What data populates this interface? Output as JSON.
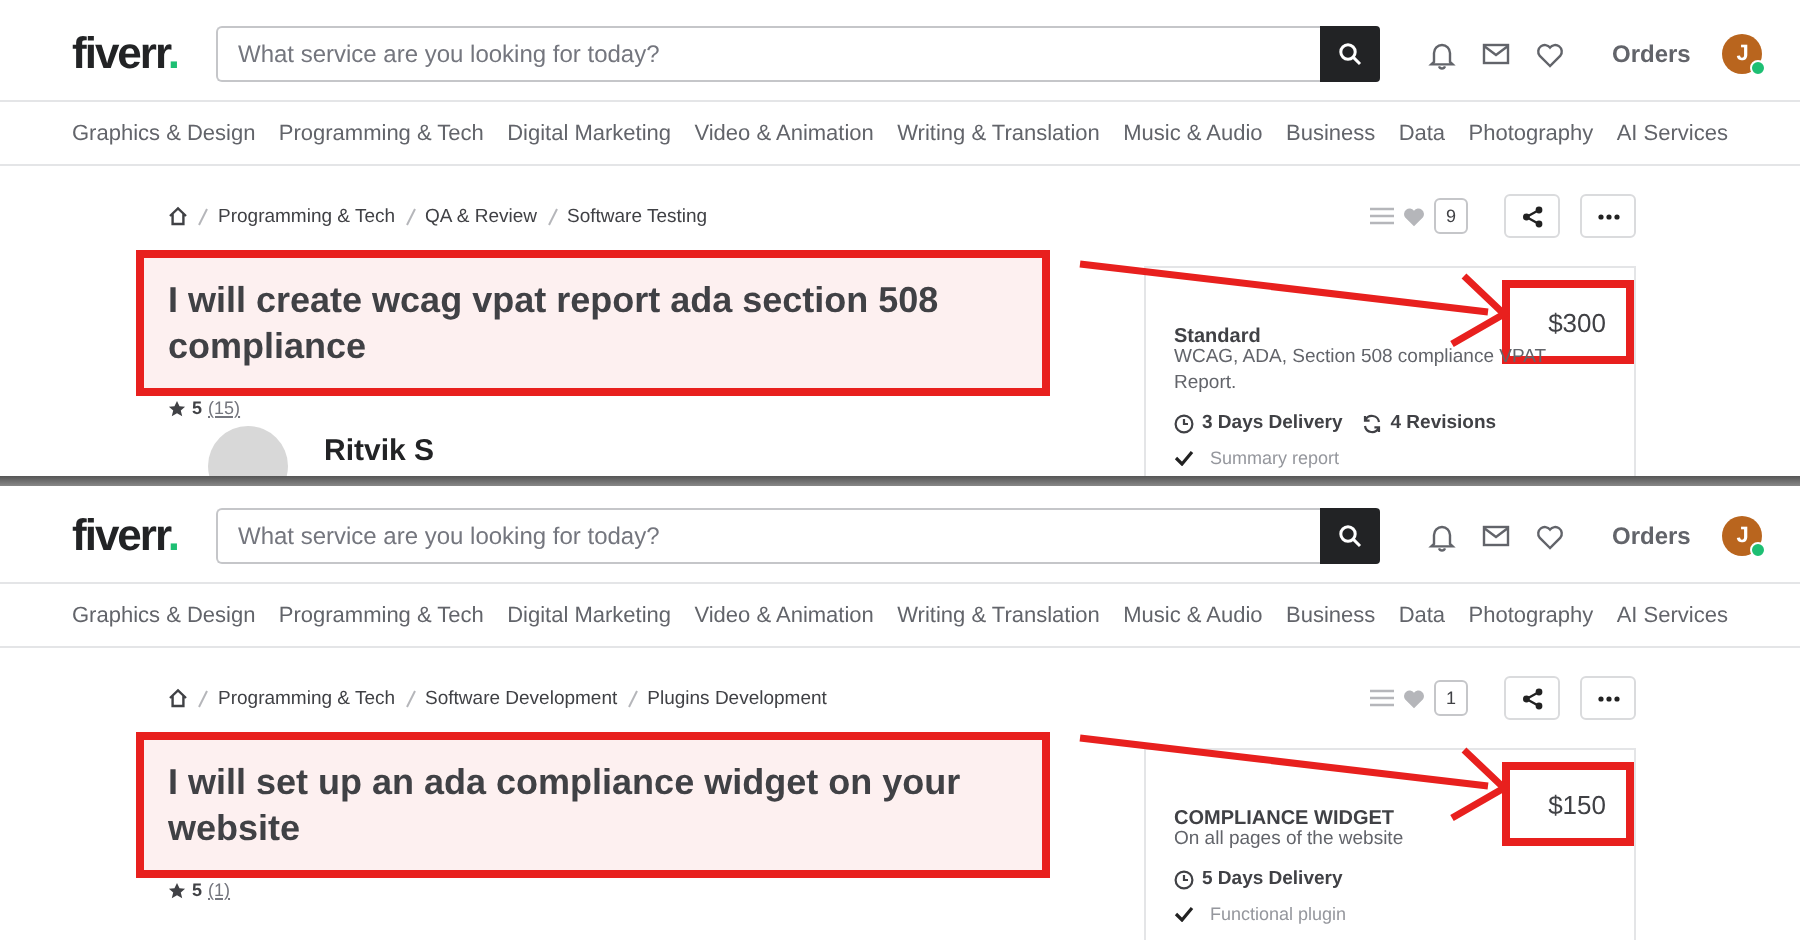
{
  "panels": [
    {
      "header": {
        "logo": "fiverr",
        "logo_dot": ".",
        "search_placeholder": "What service are you looking for today?",
        "orders": "Orders",
        "avatar": "J",
        "online": true
      },
      "categories": [
        "Graphics & Design",
        "Programming & Tech",
        "Digital Marketing",
        "Video & Animation",
        "Writing & Translation",
        "Music & Audio",
        "Business",
        "Data",
        "Photography",
        "AI Services"
      ],
      "breadcrumb": [
        "Programming & Tech",
        "QA & Review",
        "Software Testing"
      ],
      "likes": "9",
      "title": "I will create wcag vpat report ada section 508 compliance",
      "rating": "5",
      "reviews": "(15)",
      "seller": "Ritvik S",
      "package": {
        "name": "Standard",
        "price": "$300",
        "description": "WCAG, ADA, Section 508 compliance VPAT Report.",
        "delivery": "3 Days Delivery",
        "revisions": "4 Revisions",
        "features": [
          "Summary report"
        ]
      }
    },
    {
      "header": {
        "logo": "fiverr",
        "logo_dot": ".",
        "search_placeholder": "What service are you looking for today?",
        "orders": "Orders",
        "avatar": "J",
        "online": true
      },
      "categories": [
        "Graphics & Design",
        "Programming & Tech",
        "Digital Marketing",
        "Video & Animation",
        "Writing & Translation",
        "Music & Audio",
        "Business",
        "Data",
        "Photography",
        "AI Services"
      ],
      "breadcrumb": [
        "Programming & Tech",
        "Software Development",
        "Plugins Development"
      ],
      "likes": "1",
      "title": "I will set up an ada compliance widget on your website",
      "rating": "5",
      "reviews": "(1)",
      "package": {
        "name": "COMPLIANCE WIDGET",
        "price": "$150",
        "description": "On all pages of the website",
        "delivery": "5 Days Delivery",
        "features": [
          "Functional plugin"
        ]
      }
    }
  ]
}
